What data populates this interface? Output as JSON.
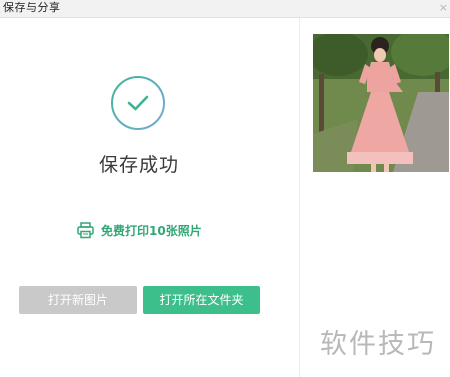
{
  "window": {
    "title": "保存与分享",
    "close_glyph": "×"
  },
  "status": {
    "icon": "check-circle-icon",
    "text": "保存成功"
  },
  "print": {
    "icon": "printer-icon",
    "label": "免费打印10张照片"
  },
  "buttons": {
    "open_new_image": "打开新图片",
    "open_folder": "打开所在文件夹"
  },
  "watermark": "软件技巧",
  "colors": {
    "accent_green": "#3dbf8c",
    "link_green": "#31a775",
    "disabled_gray": "#c9c9c9",
    "check_ring_start": "#3cb596",
    "check_ring_end": "#7aa8d8"
  }
}
